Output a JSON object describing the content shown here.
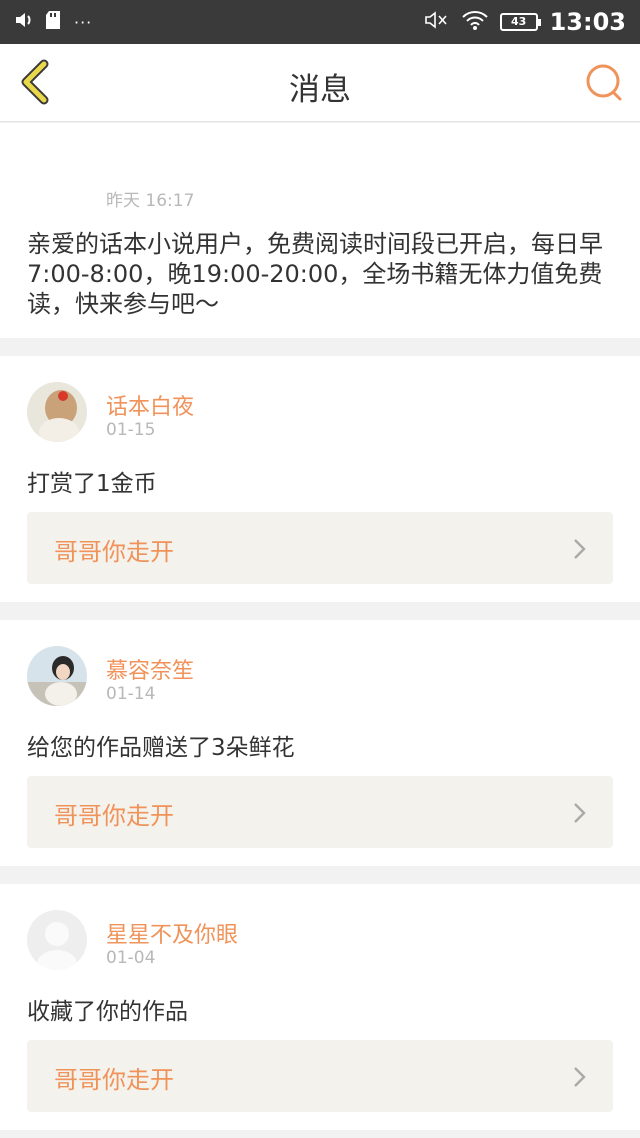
{
  "status_bar": {
    "time": "13:03",
    "battery": "43",
    "dots": "···"
  },
  "nav": {
    "title": "消息"
  },
  "system_message": {
    "time": "昨天 16:17",
    "text": "亲爱的话本小说用户，免费阅读时间段已开启，每日早7:00-8:00，晚19:00-20:00，全场书籍无体力值免费读，快来参与吧～"
  },
  "messages": [
    {
      "user": "话本白夜",
      "date": "01-15",
      "action": "打赏了1金币",
      "reply": "哥哥你走开"
    },
    {
      "user": "慕容奈笙",
      "date": "01-14",
      "action": "给您的作品赠送了3朵鲜花",
      "reply": "哥哥你走开"
    },
    {
      "user": "星星不及你眼",
      "date": "01-04",
      "action": "收藏了你的作品",
      "reply": "哥哥你走开"
    }
  ],
  "colors": {
    "accent": "#f0935a",
    "back_icon": "#e8d84a",
    "status_bar": "#3a3a3a"
  }
}
